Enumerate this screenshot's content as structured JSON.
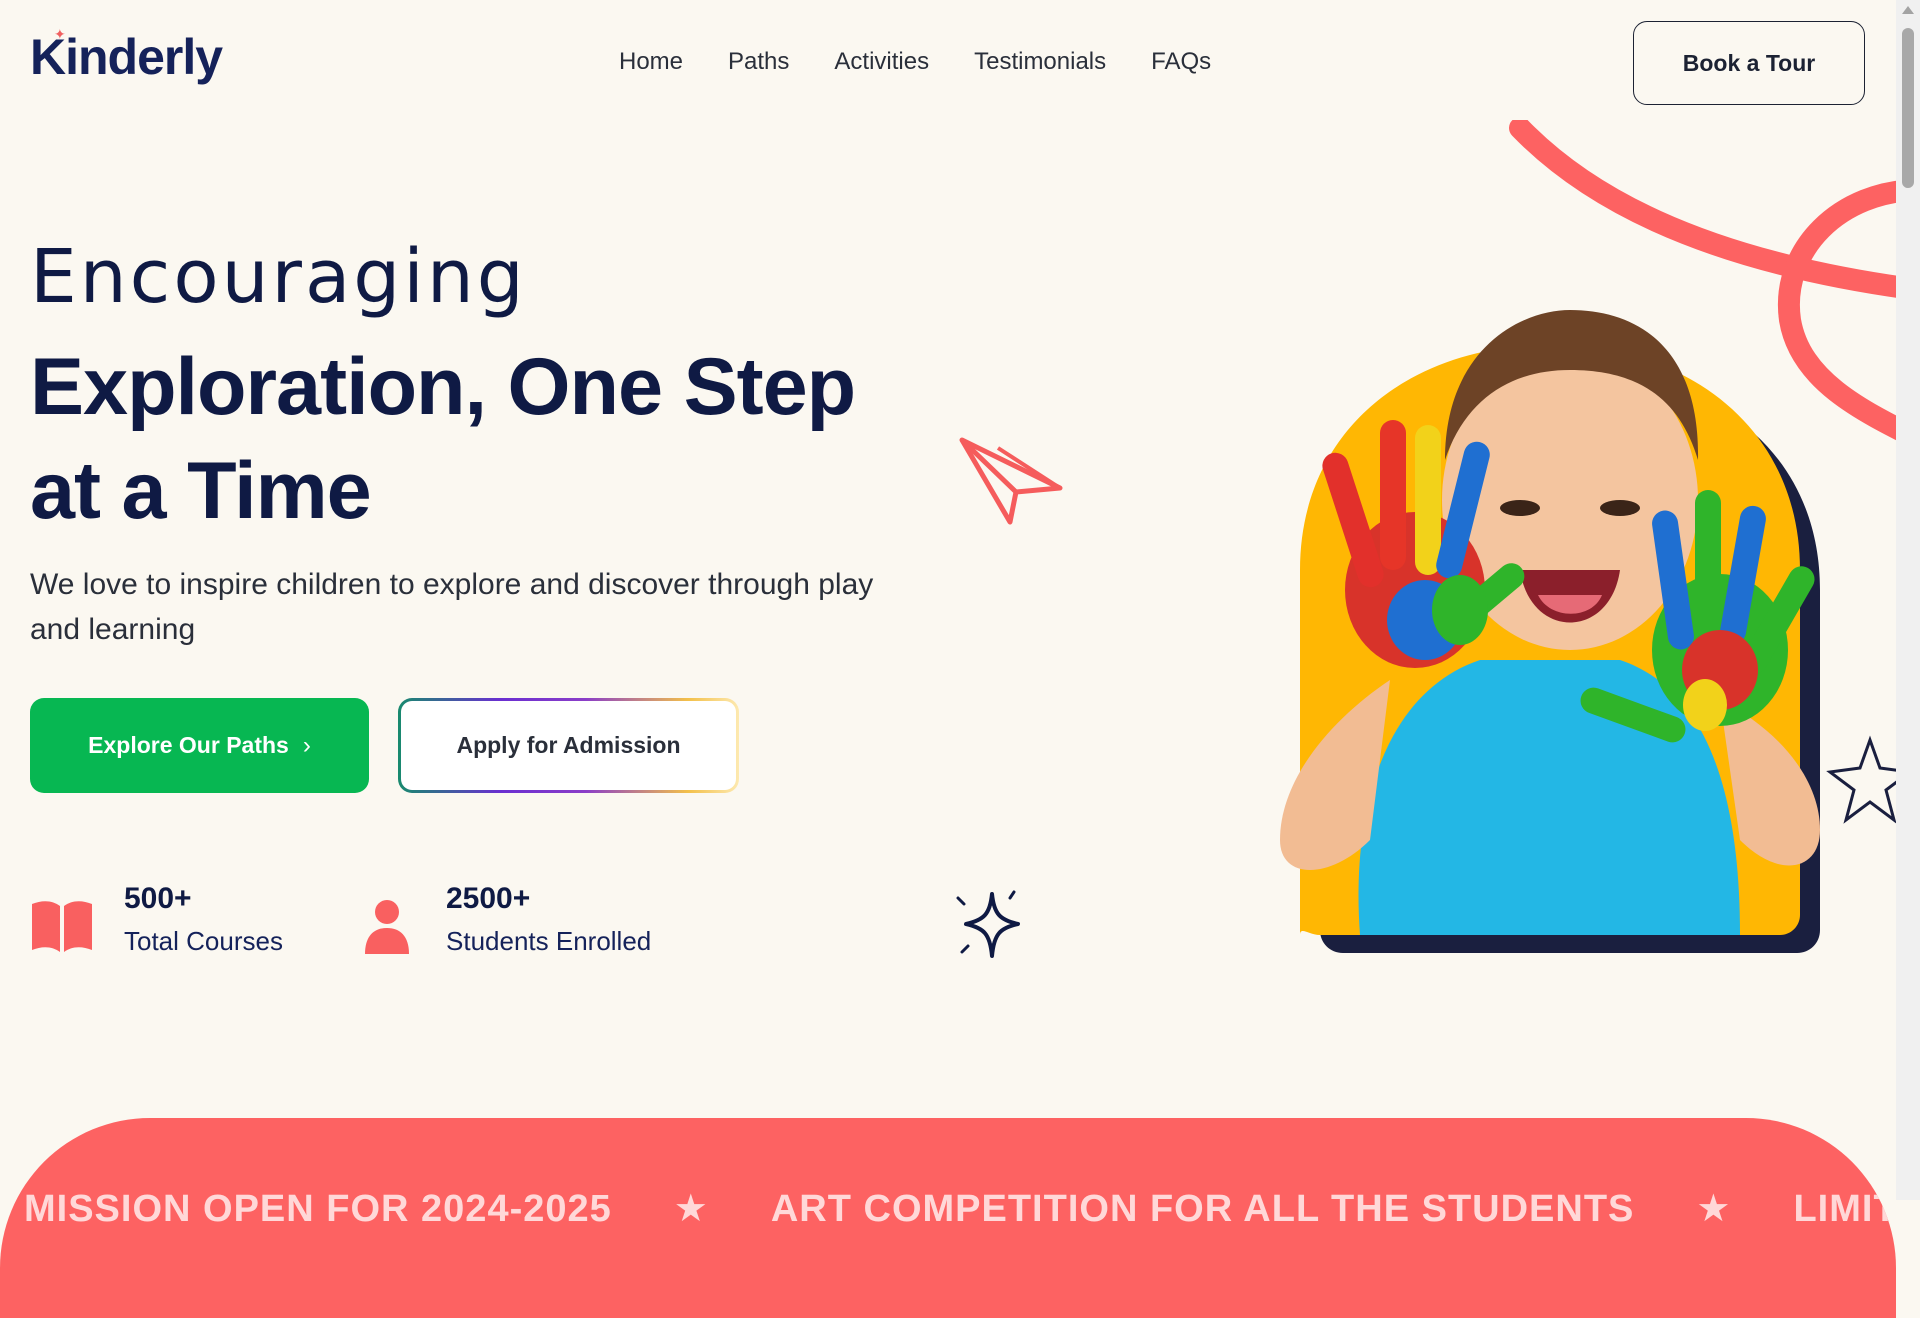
{
  "brand": {
    "name": "Kinderly",
    "accent": "#f06060"
  },
  "nav": {
    "items": [
      "Home",
      "Paths",
      "Activities",
      "Testimonials",
      "FAQs"
    ],
    "cta_label": "Book a Tour"
  },
  "hero": {
    "line1": "Encouraging",
    "line2": "Exploration, One Step at a Time",
    "subtitle": "We love to inspire children to explore and discover through play and learning",
    "primary_button": "Explore Our Paths",
    "secondary_button": "Apply for Admission"
  },
  "stats": [
    {
      "value": "500+",
      "label": "Total Courses",
      "icon": "book-icon"
    },
    {
      "value": "2500+",
      "label": "Students Enrolled",
      "icon": "user-icon"
    }
  ],
  "ticker": {
    "items": [
      "MISSION OPEN FOR 2024-2025",
      "ART COMPETITION FOR ALL THE STUDENTS",
      "LIMITED"
    ]
  },
  "colors": {
    "background": "#fbf8f1",
    "navy": "#0f1a44",
    "green": "#07b752",
    "coral": "#fd6262",
    "yellow": "#ffb703"
  }
}
